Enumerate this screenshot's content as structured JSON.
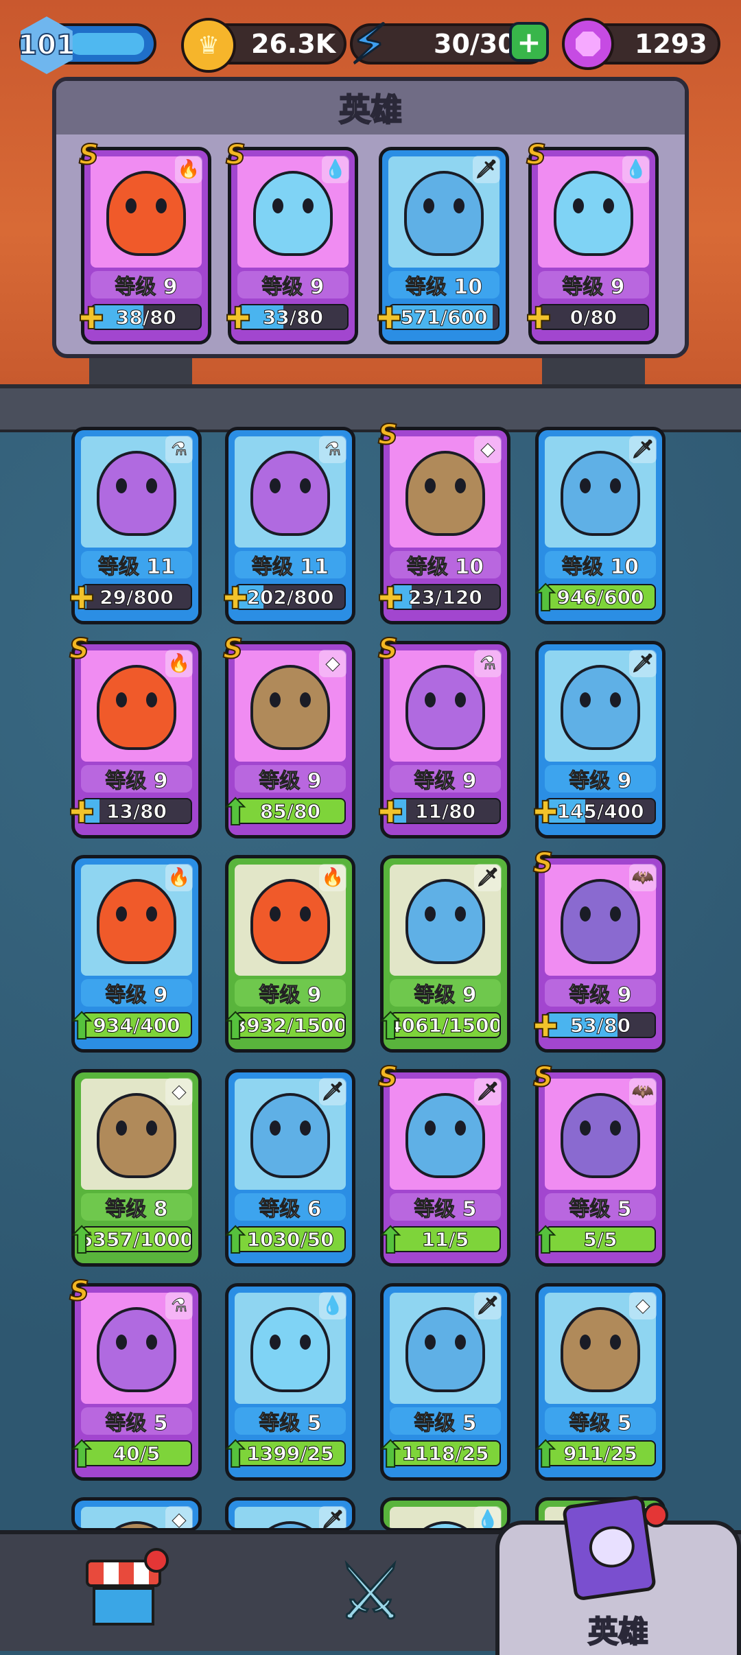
{
  "status_bar": {
    "player_level": "101",
    "gold": "26.3K",
    "energy": "30/30",
    "gems": "1293"
  },
  "team": {
    "title": "英雄",
    "heroes": [
      {
        "rarity": "purple",
        "s_rank": true,
        "element": "fire",
        "level": "等级 9",
        "progress": "38/80",
        "fill": 0.475,
        "badge": "puzzle"
      },
      {
        "rarity": "purple",
        "s_rank": true,
        "element": "water",
        "level": "等级 9",
        "progress": "33/80",
        "fill": 0.41,
        "badge": "puzzle"
      },
      {
        "rarity": "blue",
        "s_rank": false,
        "element": "sword",
        "level": "等级 10",
        "progress": "571/600",
        "fill": 0.95,
        "badge": "puzzle"
      },
      {
        "rarity": "purple",
        "s_rank": true,
        "element": "water",
        "level": "等级 9",
        "progress": "0/80",
        "fill": 0.0,
        "badge": "puzzle"
      }
    ]
  },
  "collection": [
    {
      "rarity": "blue",
      "s_rank": false,
      "element": "potion",
      "level": "等级 11",
      "progress": "29/800",
      "fill": 0.04,
      "badge": "puzzle"
    },
    {
      "rarity": "blue",
      "s_rank": false,
      "element": "potion",
      "level": "等级 11",
      "progress": "202/800",
      "fill": 0.25,
      "badge": "puzzle"
    },
    {
      "rarity": "purple",
      "s_rank": true,
      "element": "rock",
      "level": "等级 10",
      "progress": "23/120",
      "fill": 0.19,
      "badge": "puzzle"
    },
    {
      "rarity": "blue",
      "s_rank": false,
      "element": "sword",
      "level": "等级 10",
      "progress": "946/600",
      "fill": 1.0,
      "badge": "up"
    },
    {
      "rarity": "purple",
      "s_rank": true,
      "element": "fire",
      "level": "等级 9",
      "progress": "13/80",
      "fill": 0.16,
      "badge": "puzzle"
    },
    {
      "rarity": "purple",
      "s_rank": true,
      "element": "rock",
      "level": "等级 9",
      "progress": "85/80",
      "fill": 1.0,
      "badge": "up"
    },
    {
      "rarity": "purple",
      "s_rank": true,
      "element": "potion",
      "level": "等级 9",
      "progress": "11/80",
      "fill": 0.14,
      "badge": "puzzle"
    },
    {
      "rarity": "blue",
      "s_rank": false,
      "element": "sword",
      "level": "等级 9",
      "progress": "145/400",
      "fill": 0.36,
      "badge": "puzzle"
    },
    {
      "rarity": "blue",
      "s_rank": false,
      "element": "fire",
      "level": "等级 9",
      "progress": "934/400",
      "fill": 1.0,
      "badge": "up"
    },
    {
      "rarity": "green",
      "s_rank": false,
      "element": "fire",
      "level": "等级 9",
      "progress": "3932/1500",
      "fill": 1.0,
      "badge": "up"
    },
    {
      "rarity": "green",
      "s_rank": false,
      "element": "sword",
      "level": "等级 9",
      "progress": "4061/1500",
      "fill": 1.0,
      "badge": "up"
    },
    {
      "rarity": "purple",
      "s_rank": true,
      "element": "bat",
      "level": "等级 9",
      "progress": "53/80",
      "fill": 0.66,
      "badge": "puzzle"
    },
    {
      "rarity": "green",
      "s_rank": false,
      "element": "rock",
      "level": "等级 8",
      "progress": "5357/1000",
      "fill": 1.0,
      "badge": "up"
    },
    {
      "rarity": "blue",
      "s_rank": false,
      "element": "sword",
      "level": "等级 6",
      "progress": "1030/50",
      "fill": 1.0,
      "badge": "up"
    },
    {
      "rarity": "purple",
      "s_rank": true,
      "element": "sword",
      "level": "等级 5",
      "progress": "11/5",
      "fill": 1.0,
      "badge": "up"
    },
    {
      "rarity": "purple",
      "s_rank": true,
      "element": "bat",
      "level": "等级 5",
      "progress": "5/5",
      "fill": 1.0,
      "badge": "up"
    },
    {
      "rarity": "purple",
      "s_rank": true,
      "element": "potion",
      "level": "等级 5",
      "progress": "40/5",
      "fill": 1.0,
      "badge": "up"
    },
    {
      "rarity": "blue",
      "s_rank": false,
      "element": "water",
      "level": "等级 5",
      "progress": "1399/25",
      "fill": 1.0,
      "badge": "up"
    },
    {
      "rarity": "blue",
      "s_rank": false,
      "element": "sword",
      "level": "等级 5",
      "progress": "1118/25",
      "fill": 1.0,
      "badge": "up"
    },
    {
      "rarity": "blue",
      "s_rank": false,
      "element": "rock",
      "level": "等级 5",
      "progress": "911/25",
      "fill": 1.0,
      "badge": "up"
    }
  ],
  "partial_row": [
    {
      "rarity": "blue",
      "element": "rock"
    },
    {
      "rarity": "blue",
      "element": "sword"
    },
    {
      "rarity": "green",
      "element": "water"
    },
    {
      "rarity": "green",
      "element": "none"
    }
  ],
  "s_rank_label": "S",
  "element_glyphs": {
    "fire": "🔥",
    "water": "💧",
    "sword": "🗡",
    "potion": "⚗",
    "rock": "◆",
    "bat": "🦇",
    "none": ""
  },
  "element_colors": {
    "fire": "#f05a2a",
    "water": "#7fd3f5",
    "sword": "#5fb0e6",
    "potion": "#b06ae0",
    "rock": "#b08a5a",
    "bat": "#8a6ad0",
    "none": "transparent"
  },
  "badge_glyphs": {
    "puzzle": "✚",
    "up": "⬆"
  },
  "nav": {
    "shop_label": "",
    "battle_label": "",
    "heroes_label": "英雄"
  },
  "colors": {
    "accent_blue": "#2b8ee4",
    "accent_purple": "#a246cf",
    "accent_green": "#59b43c",
    "progress_full": "#7ed43a",
    "progress_partial": "#4ab4ef"
  }
}
